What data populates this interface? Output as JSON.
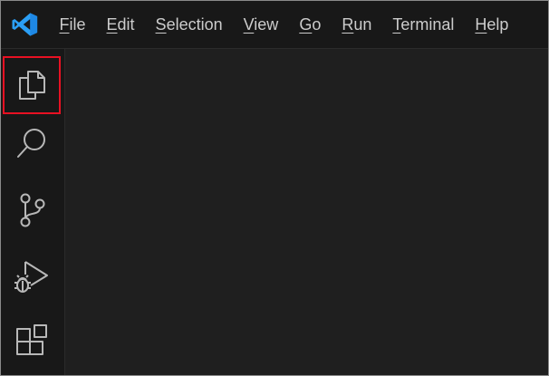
{
  "menu": {
    "items": [
      {
        "mnemonic": "F",
        "rest": "ile"
      },
      {
        "mnemonic": "E",
        "rest": "dit"
      },
      {
        "mnemonic": "S",
        "rest": "election"
      },
      {
        "mnemonic": "V",
        "rest": "iew"
      },
      {
        "mnemonic": "G",
        "rest": "o"
      },
      {
        "mnemonic": "R",
        "rest": "un"
      },
      {
        "mnemonic": "T",
        "rest": "erminal"
      },
      {
        "mnemonic": "H",
        "rest": "elp"
      }
    ]
  },
  "activity_bar": {
    "items": [
      {
        "icon": "files-icon",
        "highlighted": true
      },
      {
        "icon": "search-icon",
        "highlighted": false
      },
      {
        "icon": "source-control-icon",
        "highlighted": false
      },
      {
        "icon": "run-debug-icon",
        "highlighted": false
      },
      {
        "icon": "extensions-icon",
        "highlighted": false
      }
    ]
  },
  "colors": {
    "titlebar_bg": "#181818",
    "editor_bg": "#1f1f1f",
    "menu_text": "#cccccc",
    "icon_color": "#b8b8b8",
    "logo_blue": "#2b9ff5",
    "highlight_border": "#e81123"
  }
}
